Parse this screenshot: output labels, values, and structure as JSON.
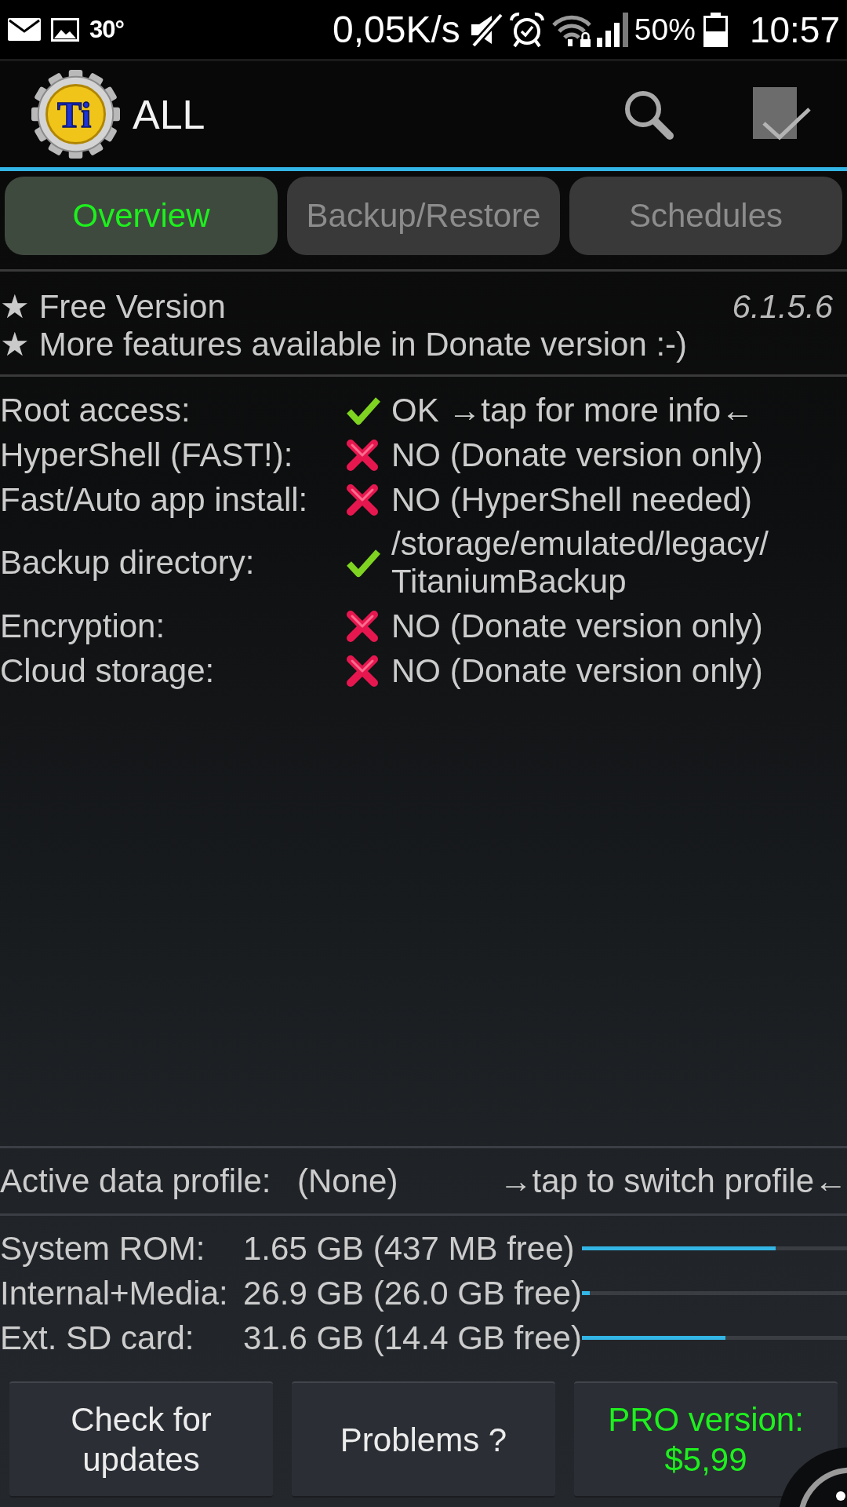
{
  "status_bar": {
    "temperature": "30°",
    "network_speed": "0,05K/s",
    "battery_percent": "50%",
    "time": "10:57"
  },
  "app_bar": {
    "logo_text": "Ti",
    "title": "ALL"
  },
  "tabs": [
    {
      "label": "Overview",
      "selected": true
    },
    {
      "label": "Backup/Restore",
      "selected": false
    },
    {
      "label": "Schedules",
      "selected": false
    }
  ],
  "version_info": {
    "features": [
      "★ Free Version",
      "★ More features available in Donate version :-)"
    ],
    "version": "6.1.5.6"
  },
  "status_items": [
    {
      "label": "Root access:",
      "ok": true,
      "value": "OK →tap for more info←"
    },
    {
      "label": "HyperShell (FAST!):",
      "ok": false,
      "value": "NO (Donate version only)"
    },
    {
      "label": "Fast/Auto app install:",
      "ok": false,
      "value": "NO (HyperShell needed)"
    },
    {
      "label": "Backup directory:",
      "ok": true,
      "value": "/storage/emulated/legacy/TitaniumBackup"
    },
    {
      "label": "Encryption:",
      "ok": false,
      "value": "NO (Donate version only)"
    },
    {
      "label": "Cloud storage:",
      "ok": false,
      "value": "NO (Donate version only)"
    }
  ],
  "data_profile": {
    "label": "Active data profile:",
    "value": "(None)",
    "action": "→tap to switch profile←"
  },
  "storage": [
    {
      "label": "System ROM:",
      "value": "1.65 GB (437 MB free)",
      "level": 0.73
    },
    {
      "label": "Internal+Media:",
      "value": "26.9 GB (26.0 GB free)",
      "level": 0.03
    },
    {
      "label": "Ext. SD card:",
      "value": "31.6 GB (14.4 GB free)",
      "level": 0.54
    }
  ],
  "buttons": [
    {
      "label": "Check for updates",
      "kind": "normal"
    },
    {
      "label": "Problems ?",
      "kind": "normal"
    },
    {
      "label": "PRO version: $5,99",
      "kind": "promo"
    }
  ]
}
